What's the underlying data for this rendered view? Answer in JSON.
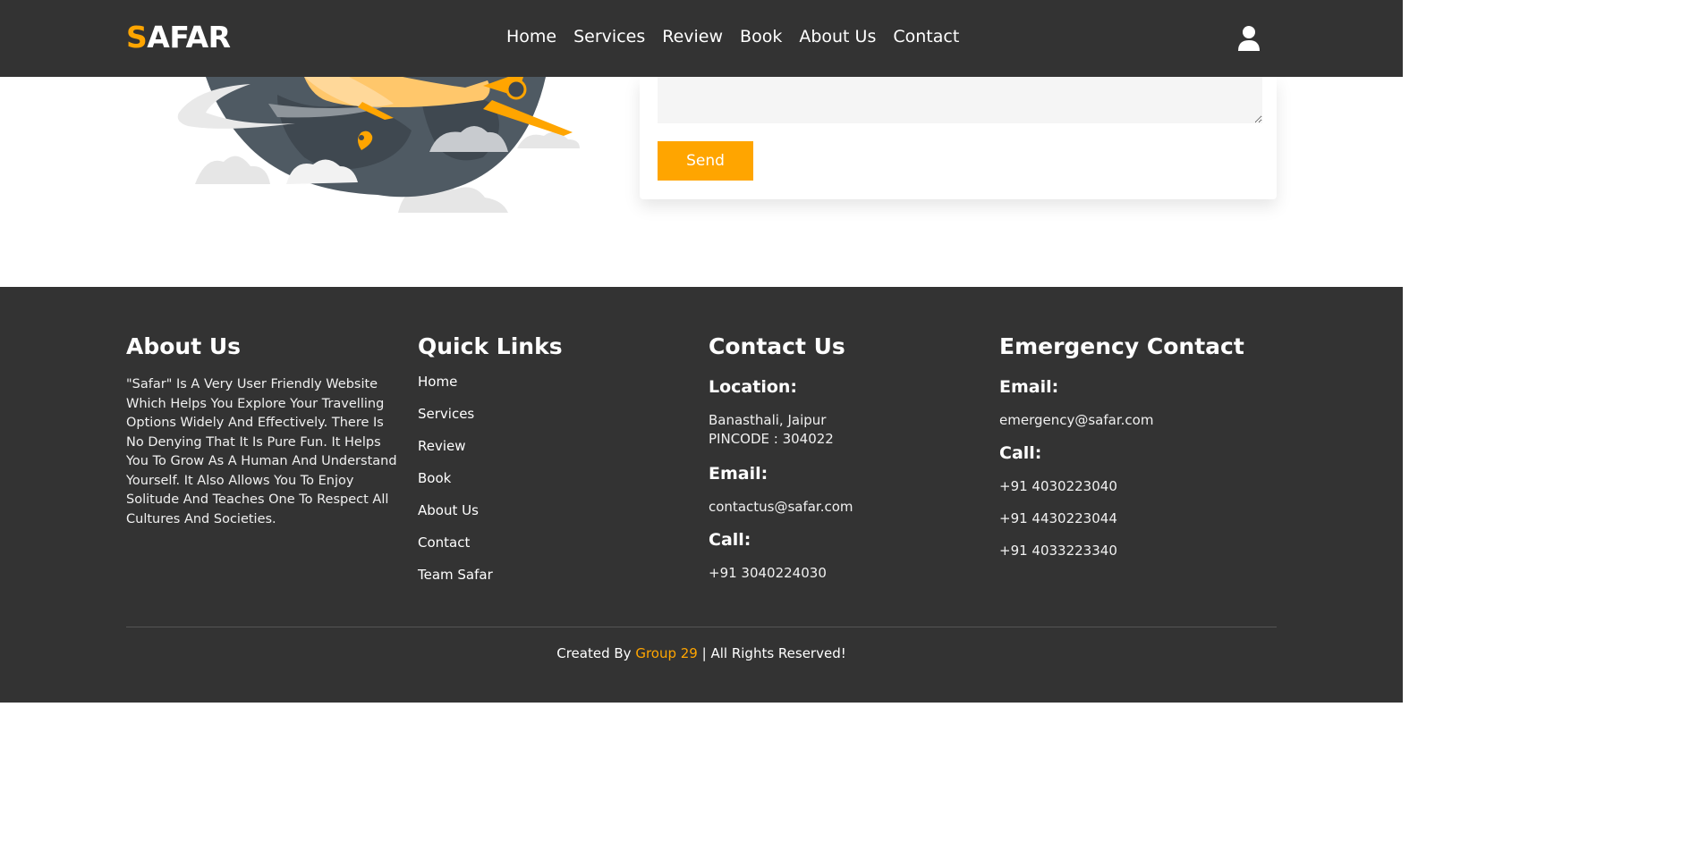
{
  "header": {
    "logo_first": "S",
    "logo_rest": "AFAR",
    "nav": [
      "Home",
      "Services",
      "Review",
      "Book",
      "About Us",
      "Contact"
    ],
    "user_icon": "user-icon"
  },
  "form": {
    "send_label": "Send"
  },
  "footer": {
    "about": {
      "title": "About Us",
      "text": "\"Safar\" Is A Very User Friendly Website Which Helps You Explore Your Travelling Options Widely And Effectively. There Is No Denying That It Is Pure Fun. It Helps You To Grow As A Human And Understand Yourself. It Also Allows You To Enjoy Solitude And Teaches One To Respect All Cultures And Societies."
    },
    "quick_links": {
      "title": "Quick Links",
      "items": [
        "Home",
        "Services",
        "Review",
        "Book",
        "About Us",
        "Contact",
        "Team Safar"
      ]
    },
    "contact": {
      "title": "Contact Us",
      "location_label": "Location:",
      "location_line1": "Banasthali, Jaipur",
      "location_line2": "PINCODE : 304022",
      "email_label": "Email:",
      "email": "contactus@safar.com",
      "call_label": "Call:",
      "phone": "+91 3040224030"
    },
    "emergency": {
      "title": "Emergency Contact",
      "email_label": "Email:",
      "email": "emergency@safar.com",
      "call_label": "Call:",
      "phones": [
        "+91 4030223040",
        "+91 4430223044",
        "+91 4033223340"
      ]
    },
    "credit": {
      "prefix": "Created By",
      "group": "Group 29",
      "suffix": "| All Rights Reserved!"
    }
  },
  "colors": {
    "accent": "#ffa500",
    "dark": "#333333"
  }
}
